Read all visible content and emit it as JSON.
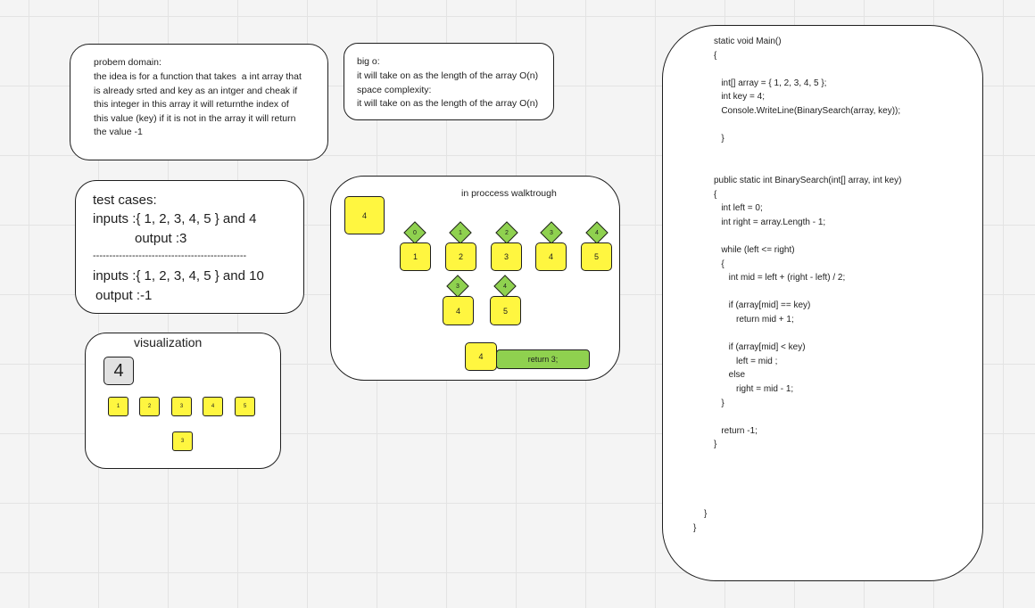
{
  "problem": {
    "lines": [
      "probem domain:",
      "the idea is for a function that takes  a int array that",
      "is already srted and key as an intger and cheak if",
      "this integer in this array it will returnthe index of",
      "this value (key) if it is not in the array it will return",
      "the value -1"
    ]
  },
  "bigo": {
    "lines": [
      "big o:",
      "it will take on as the length of the array O(n)",
      "space complexity:",
      "it will take on as the length of the array O(n)"
    ]
  },
  "tests": {
    "title": "test cases:",
    "input1": "inputs :{ 1, 2, 3, 4, 5 } and 4",
    "output1": "output :3",
    "divider": "-----------------------------------------------",
    "input2": "inputs :{ 1, 2, 3, 4, 5 } and 10",
    "output2": "output :-1"
  },
  "visualization": {
    "title": "visualization",
    "key": "4",
    "items": [
      "1",
      "2",
      "3",
      "4",
      "5"
    ],
    "result": "3"
  },
  "walkthrough": {
    "title": "in proccess walktrough",
    "key": "4",
    "indices": [
      "0",
      "1",
      "2",
      "3",
      "4"
    ],
    "values": [
      "1",
      "2",
      "3",
      "4",
      "5"
    ],
    "sub_indices": [
      "3",
      "4"
    ],
    "sub_values": [
      "4",
      "5"
    ],
    "final_key": "4",
    "return_label": "return 3;"
  },
  "code": {
    "lines": [
      "static void Main()",
      "{",
      "",
      "   int[] array = { 1, 2, 3, 4, 5 };",
      "   int key = 4;",
      "   Console.WriteLine(BinarySearch(array, key));",
      "",
      "   }",
      "",
      "",
      "public static int BinarySearch(int[] array, int key)",
      "{",
      "   int left = 0;",
      "   int right = array.Length - 1;",
      "",
      "   while (left <= right)",
      "   {",
      "      int mid = left + (right - left) / 2;",
      "",
      "      if (array[mid] == key)",
      "         return mid + 1;",
      "",
      "      if (array[mid] < key)",
      "         left = mid ;",
      "      else",
      "         right = mid - 1;",
      "   }",
      "",
      "   return -1;",
      "}"
    ],
    "close_inner": "}",
    "close_outer": "}"
  }
}
